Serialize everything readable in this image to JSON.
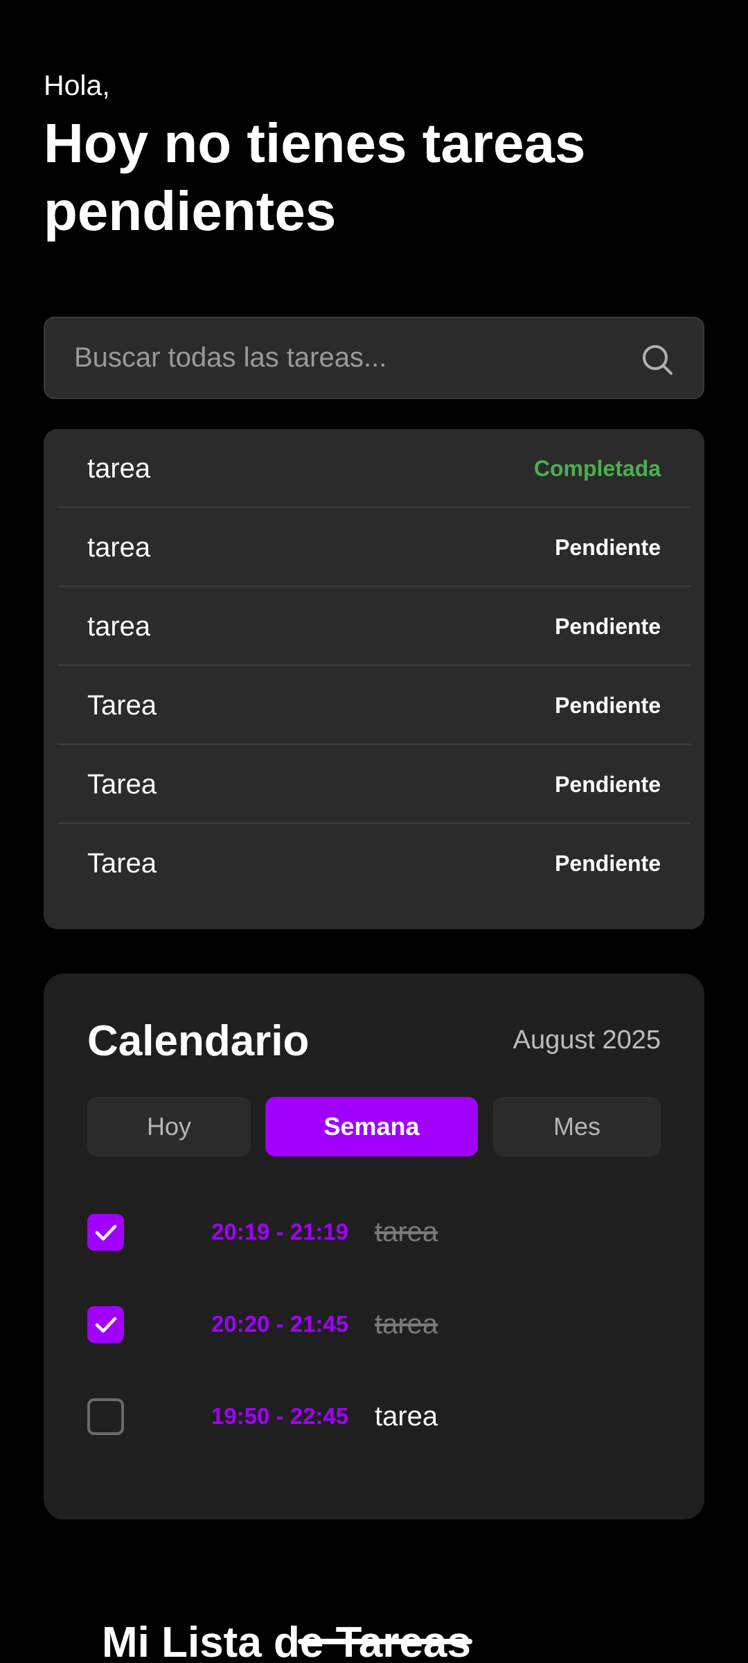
{
  "header": {
    "greeting": "Hola,",
    "headline": "Hoy no tienes tareas pendientes"
  },
  "search": {
    "placeholder": "Buscar todas las tareas...",
    "icon": "search-icon"
  },
  "tasks": [
    {
      "name": "tarea",
      "status": "Completada"
    },
    {
      "name": "tarea",
      "status": "Pendiente"
    },
    {
      "name": "tarea",
      "status": "Pendiente"
    },
    {
      "name": "Tarea",
      "status": "Pendiente"
    },
    {
      "name": "Tarea",
      "status": "Pendiente"
    },
    {
      "name": "Tarea",
      "status": "Pendiente"
    }
  ],
  "calendar": {
    "title": "Calendario",
    "month": "August 2025",
    "tabs": [
      {
        "label": "Hoy",
        "active": false
      },
      {
        "label": "Semana",
        "active": true
      },
      {
        "label": "Mes",
        "active": false
      }
    ],
    "events": [
      {
        "time": "20:19 - 21:19",
        "name": "tarea",
        "checked": true
      },
      {
        "time": "20:20 - 21:45",
        "name": "tarea",
        "checked": true
      },
      {
        "time": "19:50 - 22:45",
        "name": "tarea",
        "checked": false
      }
    ]
  },
  "footer": {
    "title": "Mi Lista de Tareas"
  },
  "colors": {
    "accent": "#a100ff",
    "completed": "#4caf50",
    "background": "#000000",
    "card": "#2b2b2b",
    "calendar_card": "#1f1f1f"
  }
}
